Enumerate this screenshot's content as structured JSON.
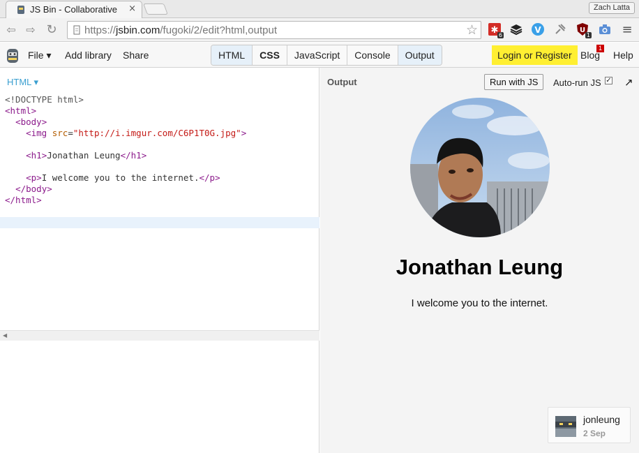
{
  "browser": {
    "tab_title": "JS Bin - Collaborative",
    "tab_close": "×",
    "profile_name": "Zach Latta",
    "url_scheme": "https://",
    "url_host": "jsbin.com",
    "url_path": "/fugoki/2/edit?html,output",
    "extensions": [
      {
        "name": "lastpass-icon",
        "badge": "6"
      },
      {
        "name": "buffer-icon",
        "badge": ""
      },
      {
        "name": "vimium-icon",
        "badge": ""
      },
      {
        "name": "pin-icon",
        "badge": ""
      },
      {
        "name": "ublock-icon",
        "badge": "1"
      },
      {
        "name": "camera-icon",
        "badge": ""
      }
    ]
  },
  "jsbin": {
    "menu": {
      "file": "File ▾",
      "add_library": "Add library",
      "share": "Share"
    },
    "panels": [
      {
        "label": "HTML",
        "active": true
      },
      {
        "label": "CSS",
        "active": false
      },
      {
        "label": "JavaScript",
        "active": false
      },
      {
        "label": "Console",
        "active": false
      },
      {
        "label": "Output",
        "active": true
      }
    ],
    "login": "Login or Register",
    "blog": "Blog",
    "blog_badge": "1",
    "help": "Help"
  },
  "editor": {
    "label": "HTML ▾",
    "lines": [
      "<!DOCTYPE html>",
      "<html>",
      "  <body>",
      "    <img src=\"http://i.imgur.com/C6P1T0G.jpg\">",
      "",
      "    <h1>Jonathan Leung</h1>",
      "",
      "    <p>I welcome you to the internet.</p>",
      "  </body>",
      "</html>"
    ]
  },
  "output": {
    "label": "Output",
    "run_button": "Run with JS",
    "autorun_label": "Auto-run JS",
    "autorun_checked": true,
    "heading": "Jonathan Leung",
    "paragraph": "I welcome you to the internet."
  },
  "user": {
    "name": "jonleung",
    "date": "2 Sep"
  },
  "colors": {
    "login_bg": "#ffef32",
    "panel_active": "#e6f0f9",
    "tag": "#8b1a8b",
    "string": "#c41a16",
    "editor_label": "#3a9fd0"
  }
}
